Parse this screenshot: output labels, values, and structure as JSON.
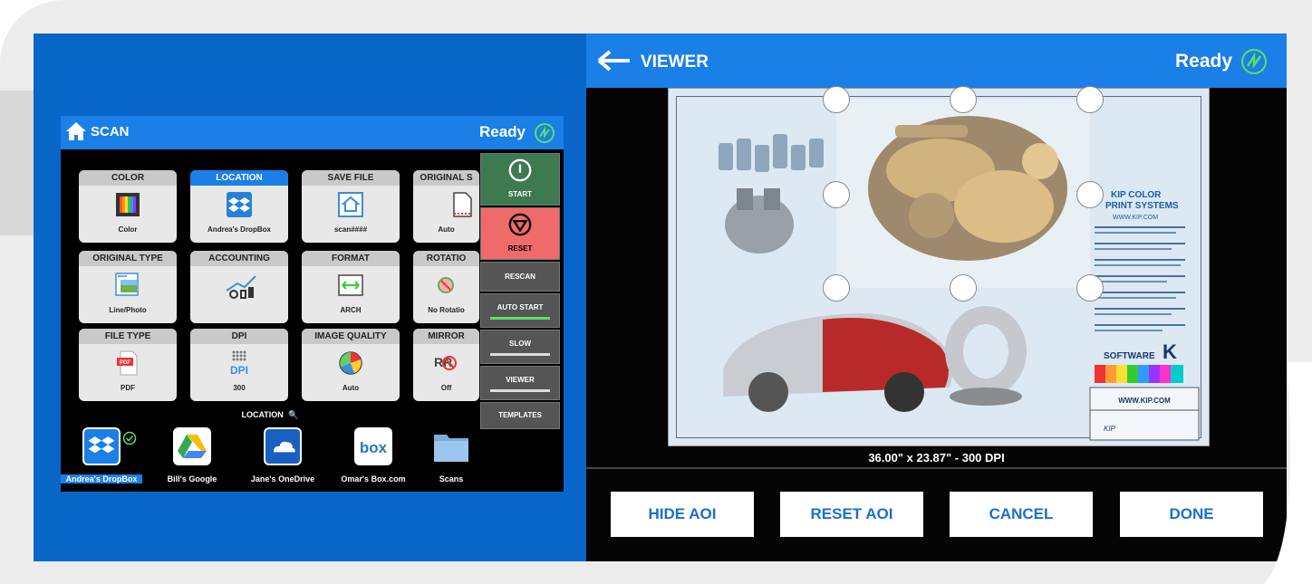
{
  "scan": {
    "title": "SCAN",
    "status": "Ready",
    "tiles": [
      {
        "label": "COLOR",
        "value": "Color"
      },
      {
        "label": "LOCATION",
        "value": "Andrea's DropBox"
      },
      {
        "label": "SAVE FILE",
        "value": "scan####"
      },
      {
        "label": "ORIGINAL S",
        "value": "Auto"
      },
      {
        "label": "ORIGINAL TYPE",
        "value": "Line/Photo"
      },
      {
        "label": "ACCOUNTING",
        "value": ""
      },
      {
        "label": "FORMAT",
        "value": "ARCH"
      },
      {
        "label": "ROTATIO",
        "value": "No Rotatio"
      },
      {
        "label": "FILE TYPE",
        "value": "PDF"
      },
      {
        "label": "DPI",
        "value": "300"
      },
      {
        "label": "IMAGE QUALITY",
        "value": "Auto"
      },
      {
        "label": "MIRROR",
        "value": "Off"
      }
    ],
    "side_buttons": {
      "start": "START",
      "reset": "RESET",
      "rescan": "RESCAN",
      "auto_start": "AUTO START",
      "slow": "SLOW",
      "viewer": "VIEWER",
      "templates": "TEMPLATES"
    },
    "location_label": "LOCATION",
    "locations": [
      {
        "name": "Andrea's DropBox",
        "icon": "dropbox-icon",
        "selected": true
      },
      {
        "name": "Bill's Google",
        "icon": "google-drive-icon",
        "selected": false
      },
      {
        "name": "Jane's OneDrive",
        "icon": "onedrive-icon",
        "selected": false
      },
      {
        "name": "Omar's Box.com",
        "icon": "box-icon",
        "selected": false
      },
      {
        "name": "Scans",
        "icon": "folder-icon",
        "selected": false
      }
    ]
  },
  "viewer": {
    "title": "VIEWER",
    "status": "Ready",
    "doc_title": "KIP COLOR PRINT SYSTEMS",
    "doc_url": "WWW.KIP.COM",
    "doc_brand": "SOFTWARE",
    "doc_footer_url": "WWW.KIP.COM",
    "dimensions": "36.00\" x 23.87\" - 300 DPI",
    "buttons": {
      "hide_aoi": "HIDE AOI",
      "reset_aoi": "RESET AOI",
      "cancel": "CANCEL",
      "done": "DONE"
    }
  },
  "colors": {
    "header_blue": "#1a7fe6",
    "panel_blue": "#0866c8",
    "start_green": "#3d7a4f",
    "reset_red": "#f06a6a",
    "ready_green": "#5ee05e"
  }
}
